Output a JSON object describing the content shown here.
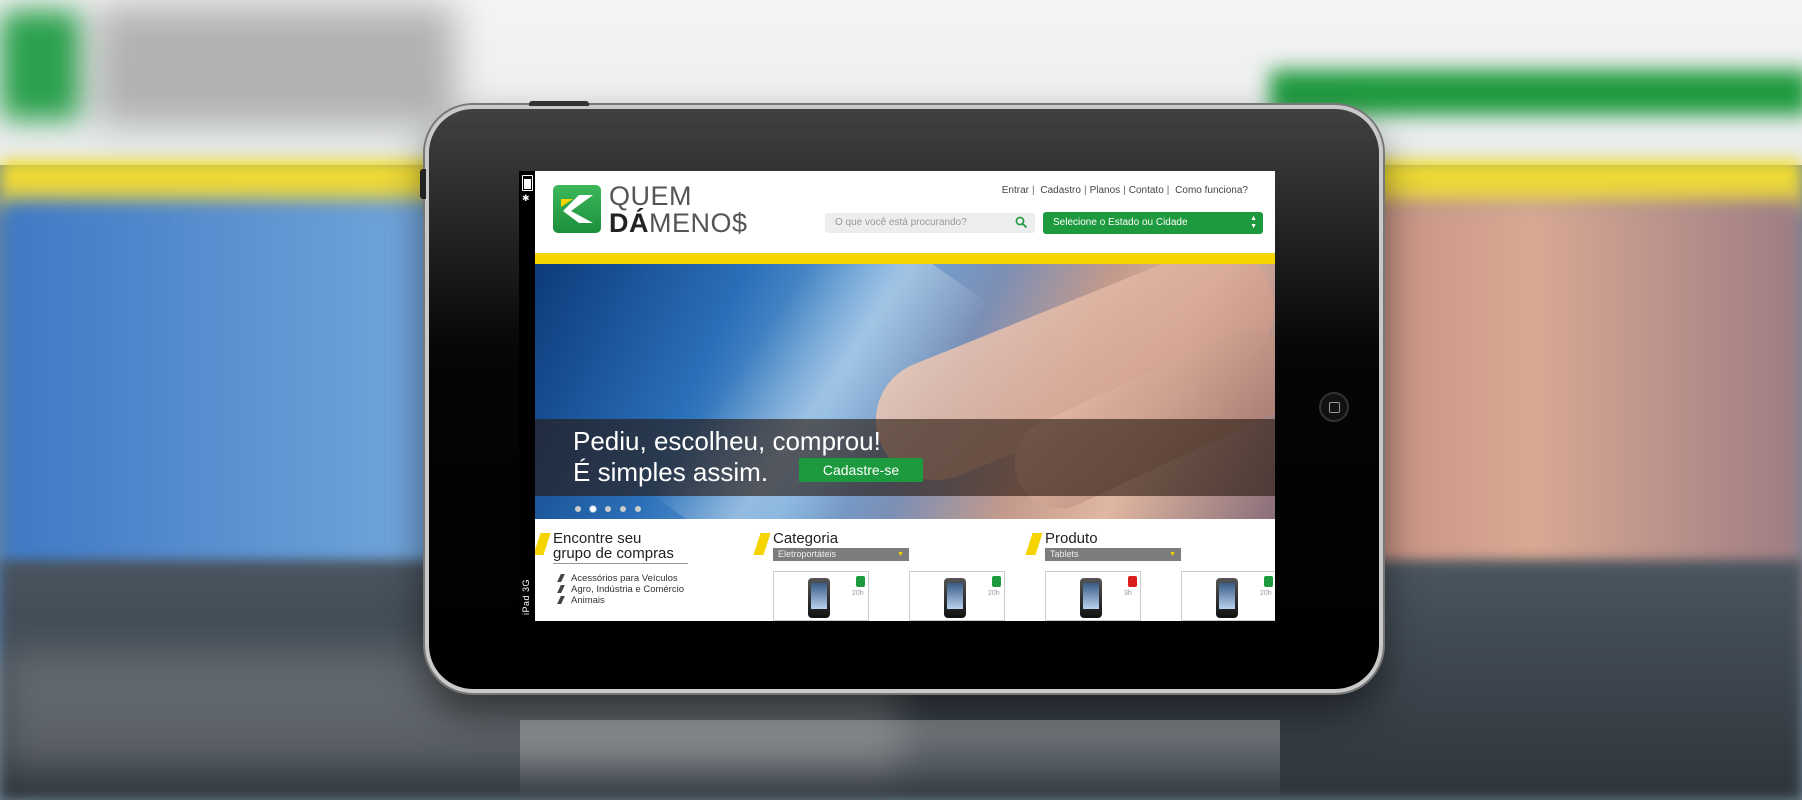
{
  "site": {
    "logo_line1": "QUEM",
    "logo_line2_bold": "DÁ",
    "logo_line2": "MENO$"
  },
  "top_links": [
    "Entrar",
    "Cadastro",
    "Planos",
    "Contato",
    "Como funciona?"
  ],
  "search": {
    "placeholder": "O que você está procurando?"
  },
  "location_select": {
    "value": "Selecione o Estado ou Cidade"
  },
  "hero": {
    "line1": "Pediu, escolheu, comprou!",
    "line2": "É simples assim.",
    "cta": "Cadastre-se",
    "slides": 5,
    "active_slide": 2
  },
  "groups": {
    "title_line1": "Encontre seu",
    "title_line2": "grupo de compras",
    "items": [
      "Acessórios para Veículos",
      "Agro, Indústria e Comércio",
      "Animais"
    ]
  },
  "category": {
    "title": "Categoria",
    "selected": "Eletroportáteis",
    "cards": [
      {
        "time": "20h",
        "lock": "green"
      },
      {
        "time": "20h",
        "lock": "green"
      }
    ]
  },
  "product": {
    "title": "Produto",
    "selected": "Tablets",
    "cards": [
      {
        "time": "3h",
        "lock": "red"
      },
      {
        "time": "20h",
        "lock": "green"
      }
    ]
  },
  "device": {
    "status": "iPad 3G"
  },
  "colors": {
    "brand_green": "#1e9a3e",
    "brand_yellow": "#f5d400",
    "lock_red": "#d91d1d"
  }
}
